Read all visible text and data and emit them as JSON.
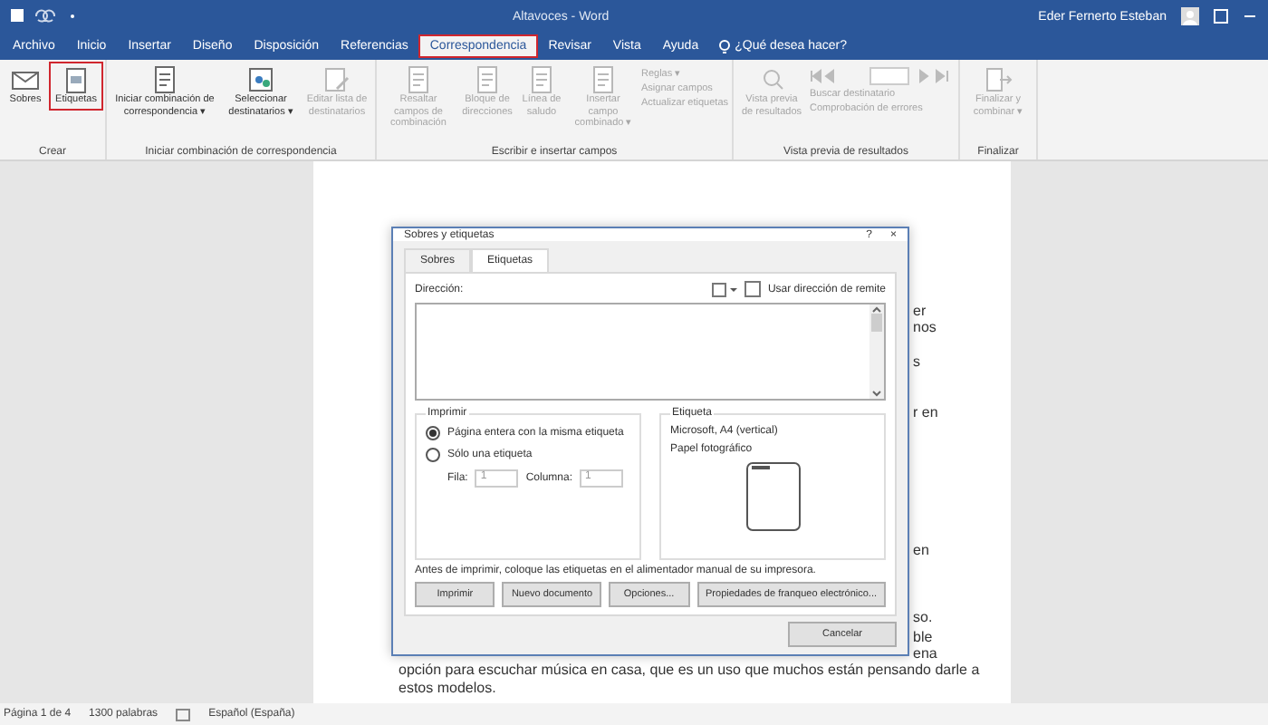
{
  "window": {
    "title": "Altavoces - Word",
    "user": "Eder Fernerto Esteban"
  },
  "ribbon_tabs": [
    {
      "label": "Archivo",
      "selected": false
    },
    {
      "label": "Inicio",
      "selected": false
    },
    {
      "label": "Insertar",
      "selected": false
    },
    {
      "label": "Diseño",
      "selected": false
    },
    {
      "label": "Disposición",
      "selected": false
    },
    {
      "label": "Referencias",
      "selected": false
    },
    {
      "label": "Correspondencia",
      "selected": true
    },
    {
      "label": "Revisar",
      "selected": false
    },
    {
      "label": "Vista",
      "selected": false
    },
    {
      "label": "Ayuda",
      "selected": false
    }
  ],
  "tell_me": {
    "placeholder": "¿Qué desea hacer?"
  },
  "ribbon_groups": [
    {
      "label": "Crear",
      "items": [
        {
          "kind": "big",
          "label": "Sobres",
          "disabled": false,
          "highlighted": false
        },
        {
          "kind": "big",
          "label": "Etiquetas",
          "disabled": false,
          "highlighted": true
        }
      ]
    },
    {
      "label": "Iniciar combinación de correspondencia",
      "items": [
        {
          "kind": "big",
          "label": "Iniciar combinación de correspondencia ▾",
          "disabled": false,
          "highlighted": false
        },
        {
          "kind": "big",
          "label": "Seleccionar destinatarios ▾",
          "disabled": false,
          "highlighted": false
        },
        {
          "kind": "big",
          "label": "Editar lista de destinatarios",
          "disabled": true,
          "highlighted": false
        }
      ]
    },
    {
      "label": "Escribir e insertar campos",
      "items": [
        {
          "kind": "big",
          "label": "Resaltar campos de combinación",
          "disabled": true,
          "highlighted": false
        },
        {
          "kind": "big",
          "label": "Bloque de direcciones",
          "disabled": true,
          "highlighted": false
        },
        {
          "kind": "big",
          "label": "Línea de saludo",
          "disabled": true,
          "highlighted": false
        },
        {
          "kind": "big",
          "label": "Insertar campo combinado ▾",
          "disabled": true,
          "highlighted": false
        },
        {
          "kind": "small",
          "labels": [
            "Reglas ▾",
            "Asignar campos",
            "Actualizar etiquetas"
          ],
          "disabled": true
        }
      ]
    },
    {
      "label": "Vista previa de resultados",
      "items": [
        {
          "kind": "big",
          "label": "Vista previa de resultados",
          "disabled": true,
          "highlighted": false
        },
        {
          "kind": "nav",
          "labels": [
            "Buscar destinatario",
            "Comprobación de errores"
          ],
          "disabled": true
        }
      ]
    },
    {
      "label": "Finalizar",
      "items": [
        {
          "kind": "big",
          "label": "Finalizar y combinar ▾",
          "disabled": true,
          "highlighted": false
        }
      ]
    }
  ],
  "document": {
    "fragments": [
      "er",
      "nos",
      "s",
      "r en",
      "en",
      "so.",
      "ble",
      "ena"
    ],
    "lines": [
      "opción para escuchar música en casa, que es un uso que muchos están pensando darle a",
      "estos modelos."
    ]
  },
  "dialog": {
    "title": "Sobres y etiquetas",
    "help": "?",
    "close": "×",
    "tabs": [
      {
        "label": "Sobres",
        "selected": false
      },
      {
        "label": "Etiquetas",
        "selected": true
      }
    ],
    "address_label": "Dirección:",
    "return_address": {
      "label": "Usar dirección de remite",
      "checked": false
    },
    "print_group": {
      "title": "Imprimir",
      "options": [
        {
          "label": "Página entera con la misma etiqueta",
          "selected": true
        },
        {
          "label": "Sólo una etiqueta",
          "selected": false
        }
      ],
      "row_label": "Fila:",
      "row_value": "1",
      "column_label": "Columna:",
      "column_value": "1"
    },
    "label_group": {
      "title": "Etiqueta",
      "lines": [
        "Microsoft, A4 (vertical)",
        "Papel fotográfico"
      ]
    },
    "note": "Antes de imprimir, coloque las etiquetas en el alimentador manual de su impresora.",
    "buttons": [
      "Imprimir",
      "Nuevo documento",
      "Opciones...",
      "Propiedades de franqueo electrónico..."
    ],
    "cancel": "Cancelar"
  },
  "status_bar": {
    "page": "Página 1 de 4",
    "words": "1300 palabras",
    "language": "Español (España)"
  }
}
